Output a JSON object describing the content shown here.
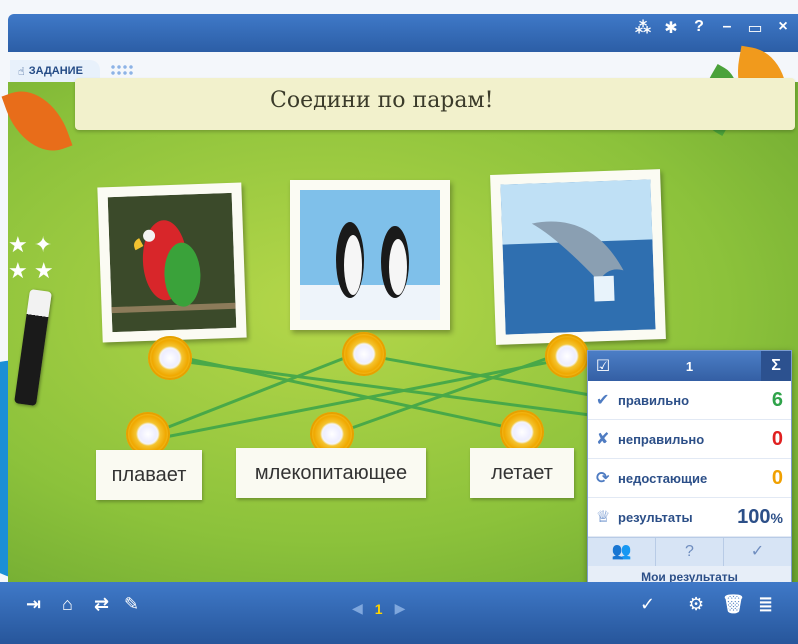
{
  "tab": {
    "label": "ЗАДАНИЕ"
  },
  "title_controls": [
    "⁂",
    "✱",
    "?",
    "–",
    "▭",
    "×"
  ],
  "task": {
    "title": "Соедини по парам!"
  },
  "images": [
    {
      "name": "parrot-photo"
    },
    {
      "name": "penguins-photo"
    },
    {
      "name": "dolphin-photo"
    }
  ],
  "words": [
    "плавает",
    "млекопитающее",
    "летает"
  ],
  "results": {
    "page_num": "1",
    "sigma": "Σ",
    "rows": [
      {
        "label": "правильно",
        "value": "6",
        "color": "#2fa34a"
      },
      {
        "label": "неправильно",
        "value": "0",
        "color": "#e02020"
      },
      {
        "label": "недостающие",
        "value": "0",
        "color": "#f0a000"
      },
      {
        "label": "результаты",
        "value": "100",
        "unit": "%",
        "color": "#2c4f88"
      }
    ],
    "footer_buttons": [
      "👥",
      "?",
      "✓"
    ],
    "footer_label": "Мои результаты"
  },
  "bottom": {
    "page_number": "1"
  },
  "colors": {
    "bar": "#2c5ea6",
    "stage": "#8cc23b",
    "line": "#3aa34a"
  }
}
